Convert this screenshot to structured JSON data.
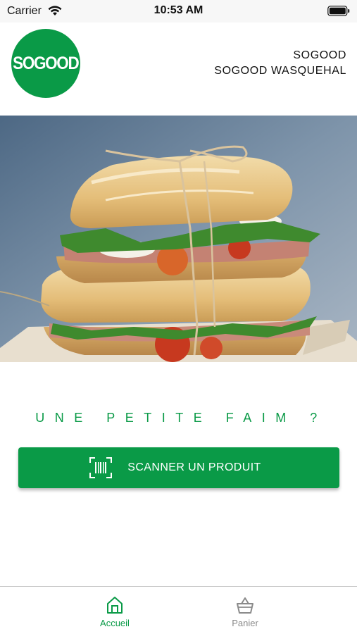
{
  "status_bar": {
    "carrier": "Carrier",
    "time": "10:53 AM",
    "icons": [
      "wifi-icon",
      "battery-icon"
    ]
  },
  "header": {
    "logo_text": "SOGOOD",
    "store_brand": "SOGOOD",
    "store_name": "SOGOOD WASQUEHAL"
  },
  "hero": {
    "image": "sandwich-photo"
  },
  "main": {
    "tagline": "UNE PETITE FAIM ?",
    "scan_button": {
      "label": "SCANNER UN PRODUIT",
      "icon": "barcode-scan-icon"
    }
  },
  "tab_bar": {
    "tabs": [
      {
        "label": "Accueil",
        "icon": "home-icon",
        "active": true
      },
      {
        "label": "Panier",
        "icon": "basket-icon",
        "active": false
      }
    ]
  },
  "colors": {
    "brand_green": "#0a9a47",
    "inactive_gray": "#8a8a8a",
    "status_bar_bg": "#f7f7f7"
  }
}
